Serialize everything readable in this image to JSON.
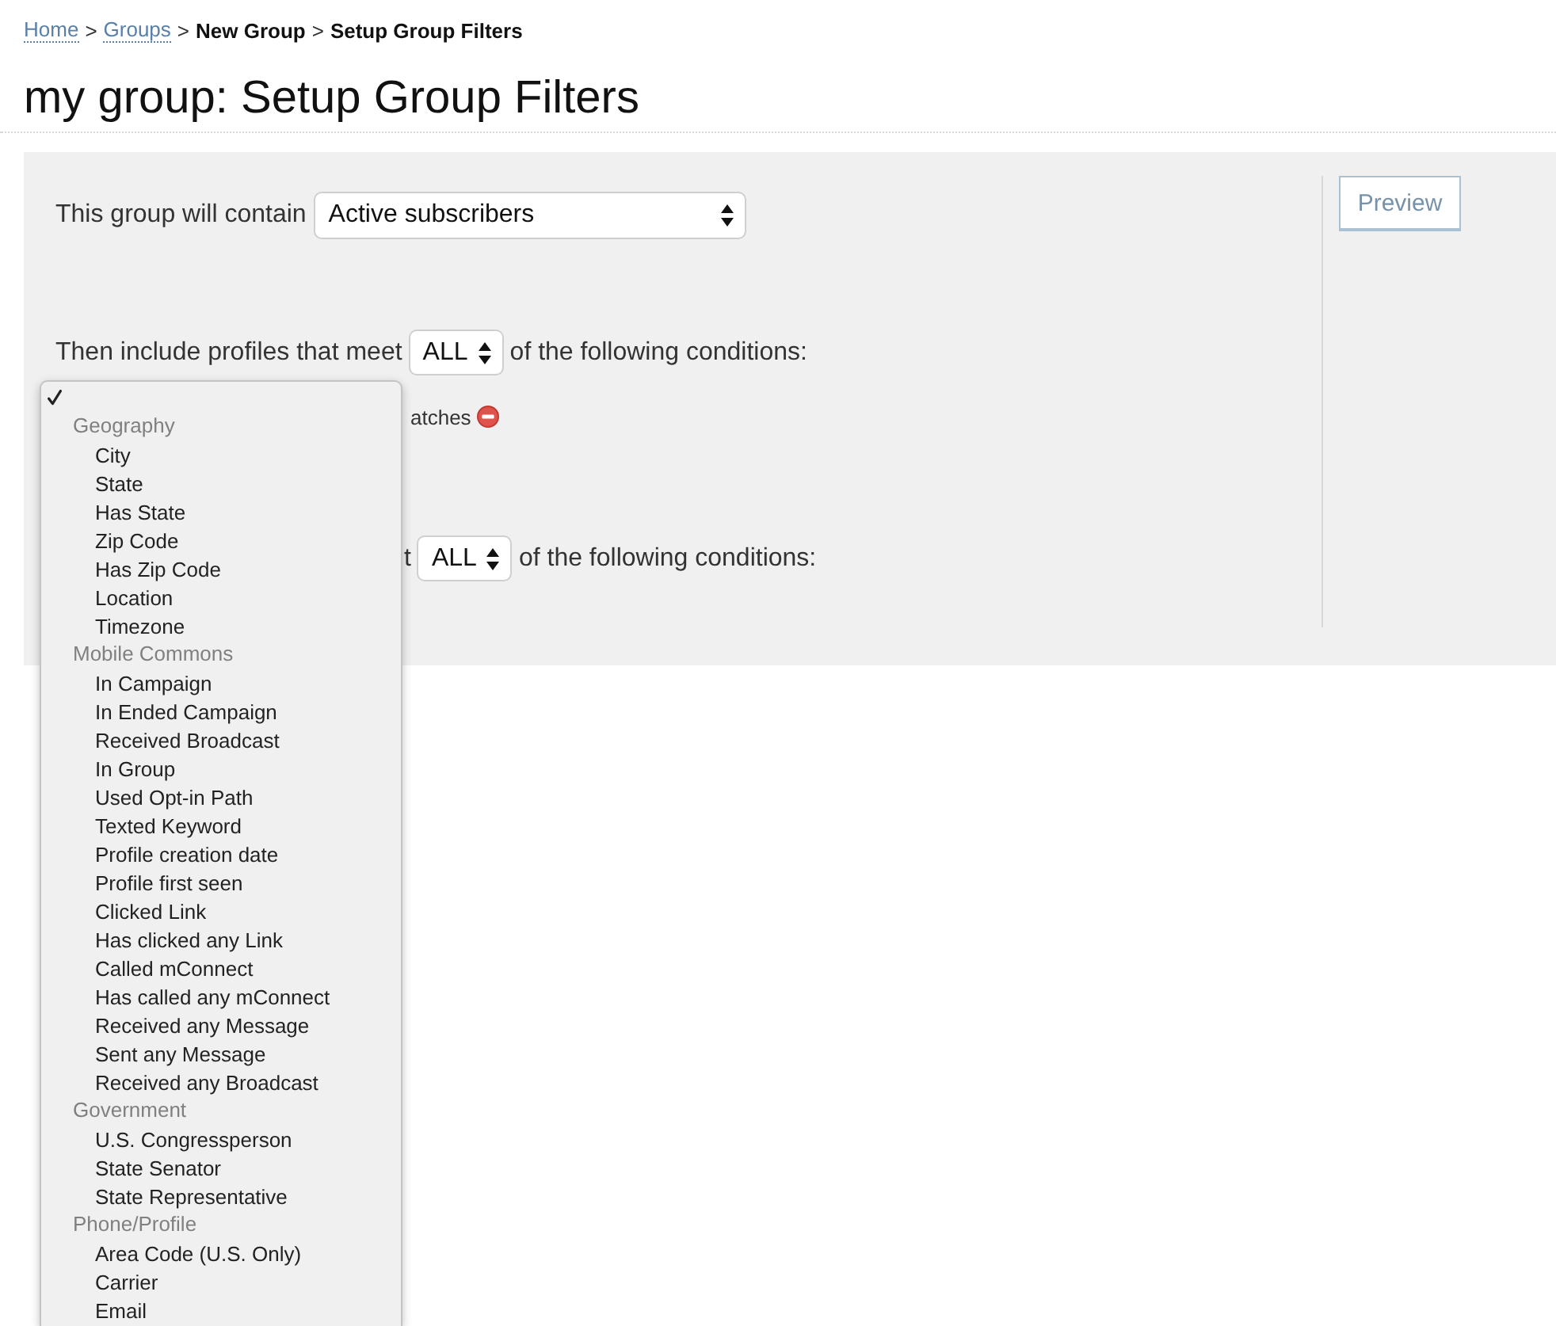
{
  "breadcrumb": {
    "items": [
      {
        "label": "Home",
        "kind": "link"
      },
      {
        "label": "Groups",
        "kind": "link"
      },
      {
        "label": "New Group",
        "kind": "text"
      },
      {
        "label": "Setup Group Filters",
        "kind": "text"
      }
    ],
    "separators": [
      ">",
      ">",
      ">"
    ]
  },
  "title": "my group: Setup Group Filters",
  "contain": {
    "label": "This group will contain",
    "select": "Active subscribers"
  },
  "condition_blocks": [
    {
      "label": "Then include profiles that meet",
      "select": "ALL",
      "suffix": "of the following conditions:",
      "rows": [
        {
          "text": "atches",
          "removable": true
        }
      ]
    },
    {
      "label": "t",
      "select": "ALL",
      "suffix": "of the following conditions:"
    }
  ],
  "preview_button": "Preview",
  "dropdown": {
    "blank_option": {
      "selected": true
    },
    "groups": [
      {
        "label": "Geography",
        "options": [
          {
            "label": "City",
            "selected": false
          },
          {
            "label": "State",
            "selected": false
          },
          {
            "label": "Has State",
            "selected": false
          },
          {
            "label": "Zip Code",
            "selected": false
          },
          {
            "label": "Has Zip Code",
            "selected": false
          },
          {
            "label": "Location",
            "selected": false
          },
          {
            "label": "Timezone",
            "selected": false
          }
        ]
      },
      {
        "label": "Mobile Commons",
        "options": [
          {
            "label": "In Campaign",
            "selected": false
          },
          {
            "label": "In Ended Campaign",
            "selected": false
          },
          {
            "label": "Received Broadcast",
            "selected": false
          },
          {
            "label": "In Group",
            "selected": false
          },
          {
            "label": "Used Opt-in Path",
            "selected": false
          },
          {
            "label": "Texted Keyword",
            "selected": false
          },
          {
            "label": "Profile creation date",
            "selected": false
          },
          {
            "label": "Profile first seen",
            "selected": false
          },
          {
            "label": "Clicked Link",
            "selected": false
          },
          {
            "label": "Has clicked any Link",
            "selected": false
          },
          {
            "label": "Called mConnect",
            "selected": false
          },
          {
            "label": "Has called any mConnect",
            "selected": false
          },
          {
            "label": "Received any Message",
            "selected": false
          },
          {
            "label": "Sent any Message",
            "selected": false
          },
          {
            "label": "Received any Broadcast",
            "selected": false
          }
        ]
      },
      {
        "label": "Government",
        "options": [
          {
            "label": "U.S. Congressperson",
            "selected": false
          },
          {
            "label": "State Senator",
            "selected": false
          },
          {
            "label": "State Representative",
            "selected": false
          }
        ]
      },
      {
        "label": "Phone/Profile",
        "options": [
          {
            "label": "Area Code (U.S. Only)",
            "selected": false
          },
          {
            "label": "Carrier",
            "selected": false
          },
          {
            "label": "Email",
            "selected": false
          }
        ]
      }
    ]
  }
}
